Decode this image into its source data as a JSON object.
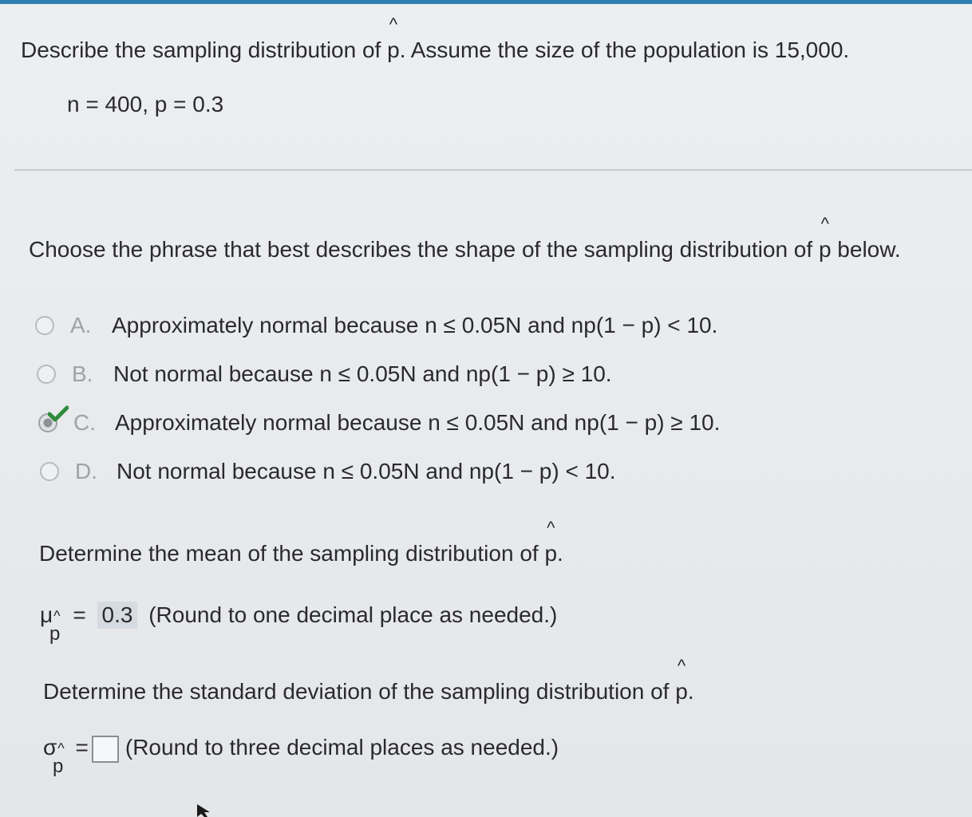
{
  "question": {
    "prompt_before": "Describe the sampling distribution of ",
    "prompt_var": "p",
    "prompt_after": ". Assume the size of the population is 15,000.",
    "given": "n = 400, p = 0.3"
  },
  "part1": {
    "prompt_before": "Choose the phrase that best describes the shape of the sampling distribution of ",
    "prompt_var": "p",
    "prompt_after": " below.",
    "options": [
      {
        "letter": "A.",
        "text": "Approximately normal because n ≤ 0.05N and np(1 − p) < 10.",
        "selected": false
      },
      {
        "letter": "B.",
        "text": "Not normal because n ≤ 0.05N and np(1 − p) ≥ 10.",
        "selected": false
      },
      {
        "letter": "C.",
        "text": "Approximately normal because n ≤ 0.05N and np(1 − p) ≥ 10.",
        "selected": true
      },
      {
        "letter": "D.",
        "text": "Not normal because n ≤ 0.05N and np(1 − p) < 10.",
        "selected": false
      }
    ]
  },
  "part2": {
    "prompt_before": "Determine the mean of the sampling distribution of ",
    "prompt_var": "p",
    "prompt_after": ".",
    "symbol": "μ",
    "symbol_hat": "^",
    "symbol_sub": "p",
    "equals": "=",
    "answer": "0.3",
    "hint": "(Round to one decimal place as needed.)"
  },
  "part3": {
    "prompt_before": "Determine the standard deviation of the sampling distribution of ",
    "prompt_var": "p",
    "prompt_after": ".",
    "symbol": "σ",
    "symbol_hat": "^",
    "symbol_sub": "p",
    "equals": "=",
    "answer": "",
    "hint": "(Round to three decimal places as needed.)"
  },
  "hat_char": "^",
  "colors": {
    "accent_bar": "#2f7fb0",
    "check": "#2e8b3a",
    "answer_bg": "#d6dbe2"
  }
}
